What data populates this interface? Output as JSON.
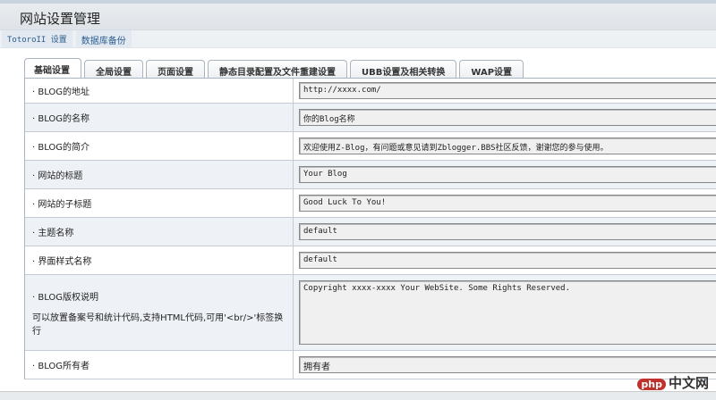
{
  "title": "网站设置管理",
  "subnav": [
    "TotoroII 设置",
    "数据库备份"
  ],
  "tabs": [
    "基础设置",
    "全局设置",
    "页面设置",
    "静态目录配置及文件重建设置",
    "UBB设置及相关转换",
    "WAP设置"
  ],
  "rows": [
    {
      "label": "· BLOG的地址",
      "value": "http://xxxx.com/"
    },
    {
      "label": "· BLOG的名称",
      "value": "你的Blog名称"
    },
    {
      "label": "· BLOG的简介",
      "value": "欢迎使用Z-Blog，有问题或意见请到Zblogger.BBS社区反馈，谢谢您的参与使用。"
    },
    {
      "label": "· 网站的标题",
      "value": "Your Blog"
    },
    {
      "label": "· 网站的子标题",
      "value": "Good Luck To You!"
    },
    {
      "label": "· 主题名称",
      "value": "default"
    },
    {
      "label": "· 界面样式名称",
      "value": "default"
    },
    {
      "label": "· BLOG版权说明",
      "sub": "可以放置备案号和统计代码,支持HTML代码,可用'<br/>'标签换行",
      "value": "Copyright xxxx-xxxx Your WebSite. Some Rights Reserved."
    },
    {
      "label": "· BLOG所有者",
      "value": "拥有者"
    }
  ],
  "watermark": {
    "logo": "php",
    "text": "中文网"
  }
}
